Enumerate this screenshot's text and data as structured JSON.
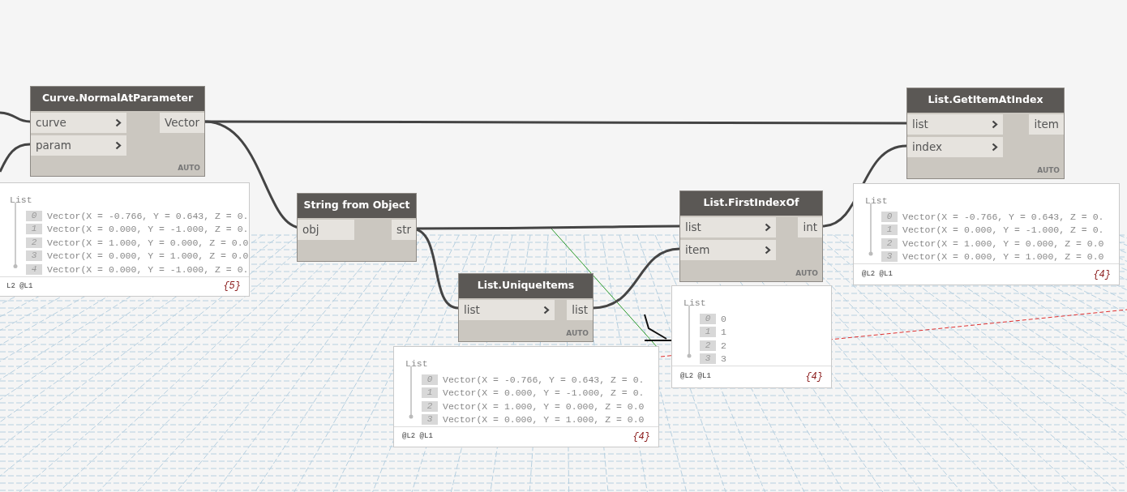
{
  "nodes": [
    {
      "title": "Curve.NormalAtParameter",
      "inputs": [
        {
          "name": "curve",
          "arrow": true
        },
        {
          "name": "param",
          "arrow": true
        }
      ],
      "outputs": [
        "Vector"
      ],
      "lacing": "AUTO",
      "watch": {
        "header": "List",
        "items": [
          {
            "index": "0",
            "value": "Vector(X = -0.766, Y = 0.643, Z = 0."
          },
          {
            "index": "1",
            "value": "Vector(X = 0.000, Y = -1.000, Z = 0."
          },
          {
            "index": "2",
            "value": "Vector(X = 1.000, Y = 0.000, Z = 0.0"
          },
          {
            "index": "3",
            "value": "Vector(X = 0.000, Y = 1.000, Z = 0.0"
          },
          {
            "index": "4",
            "value": "Vector(X = 0.000, Y = -1.000, Z = 0."
          }
        ],
        "levels": "L2 @L1",
        "count": "{5}"
      }
    },
    {
      "title": "String from Object",
      "inputs": [
        {
          "name": "obj",
          "arrow": false
        }
      ],
      "outputs": [
        "str"
      ]
    },
    {
      "title": "List.UniqueItems",
      "inputs": [
        {
          "name": "list",
          "arrow": true
        }
      ],
      "outputs": [
        "list"
      ],
      "lacing": "AUTO",
      "watch": {
        "header": "List",
        "items": [
          {
            "index": "0",
            "value": "Vector(X = -0.766, Y = 0.643, Z = 0."
          },
          {
            "index": "1",
            "value": "Vector(X = 0.000, Y = -1.000, Z = 0."
          },
          {
            "index": "2",
            "value": "Vector(X = 1.000, Y = 0.000, Z = 0.0"
          },
          {
            "index": "3",
            "value": "Vector(X = 0.000, Y = 1.000, Z = 0.0"
          }
        ],
        "levels": "@L2 @L1",
        "count": "{4}"
      }
    },
    {
      "title": "List.FirstIndexOf",
      "inputs": [
        {
          "name": "list",
          "arrow": true
        },
        {
          "name": "item",
          "arrow": true
        }
      ],
      "outputs": [
        "int"
      ],
      "lacing": "AUTO",
      "watch": {
        "header": "List",
        "items": [
          {
            "index": "0",
            "value": "0"
          },
          {
            "index": "1",
            "value": "1"
          },
          {
            "index": "2",
            "value": "2"
          },
          {
            "index": "3",
            "value": "3"
          }
        ],
        "levels": "@L2 @L1",
        "count": "{4}"
      }
    },
    {
      "title": "List.GetItemAtIndex",
      "inputs": [
        {
          "name": "list",
          "arrow": true
        },
        {
          "name": "index",
          "arrow": true
        }
      ],
      "outputs": [
        "item"
      ],
      "lacing": "AUTO",
      "watch": {
        "header": "List",
        "items": [
          {
            "index": "0",
            "value": "Vector(X = -0.766, Y = 0.643, Z = 0."
          },
          {
            "index": "1",
            "value": "Vector(X = 0.000, Y = -1.000, Z = 0."
          },
          {
            "index": "2",
            "value": "Vector(X = 1.000, Y = 0.000, Z = 0.0"
          },
          {
            "index": "3",
            "value": "Vector(X = 0.000, Y = 1.000, Z = 0.0"
          }
        ],
        "levels": "@L2 @L1",
        "count": "{4}"
      }
    }
  ]
}
